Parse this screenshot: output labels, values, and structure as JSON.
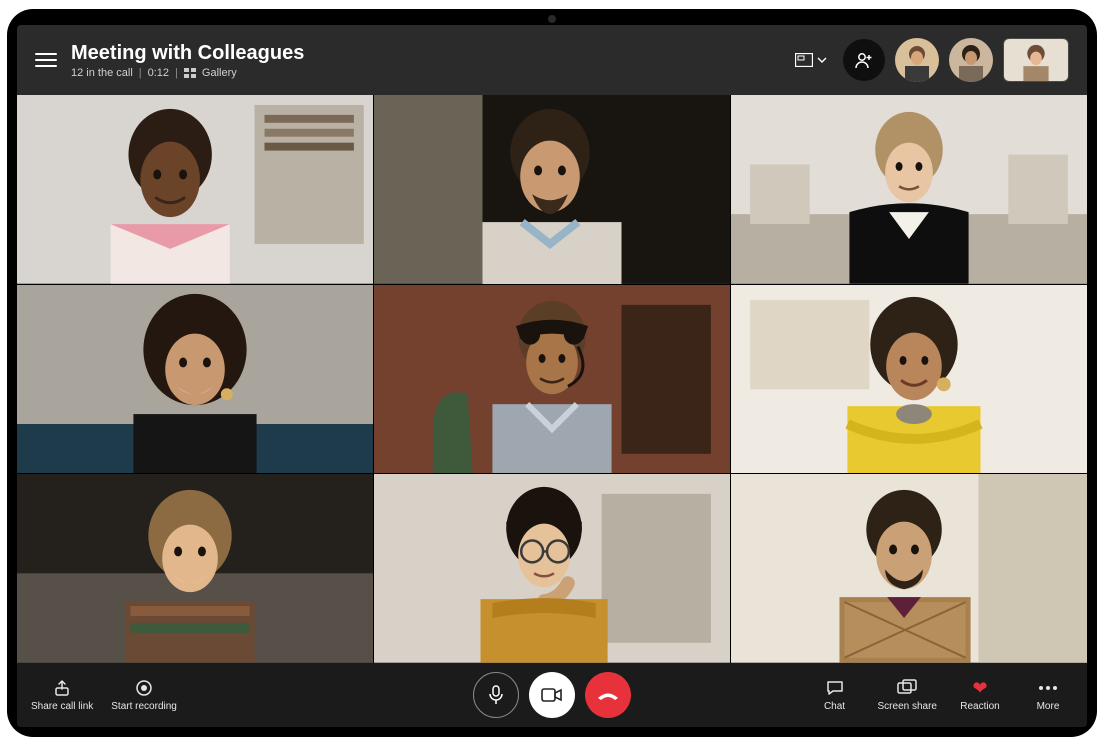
{
  "header": {
    "title": "Meeting with Colleagues",
    "participants_text": "12 in the call",
    "duration": "0:12",
    "view_mode": "Gallery"
  },
  "header_thumbnails": [
    {
      "id": "thumb-1"
    },
    {
      "id": "thumb-2"
    },
    {
      "id": "thumb-3-pip"
    }
  ],
  "grid_participants": [
    "participant-1",
    "participant-2",
    "participant-3",
    "participant-4",
    "participant-5",
    "participant-6",
    "participant-7",
    "participant-8",
    "participant-9"
  ],
  "footer": {
    "share_link": "Share call link",
    "start_recording": "Start recording",
    "chat": "Chat",
    "screen_share": "Screen share",
    "reaction": "Reaction",
    "more": "More"
  },
  "colors": {
    "hangup": "#e7323c",
    "header_bg": "#2b2b2b",
    "footer_bg": "#1b1b1b"
  }
}
